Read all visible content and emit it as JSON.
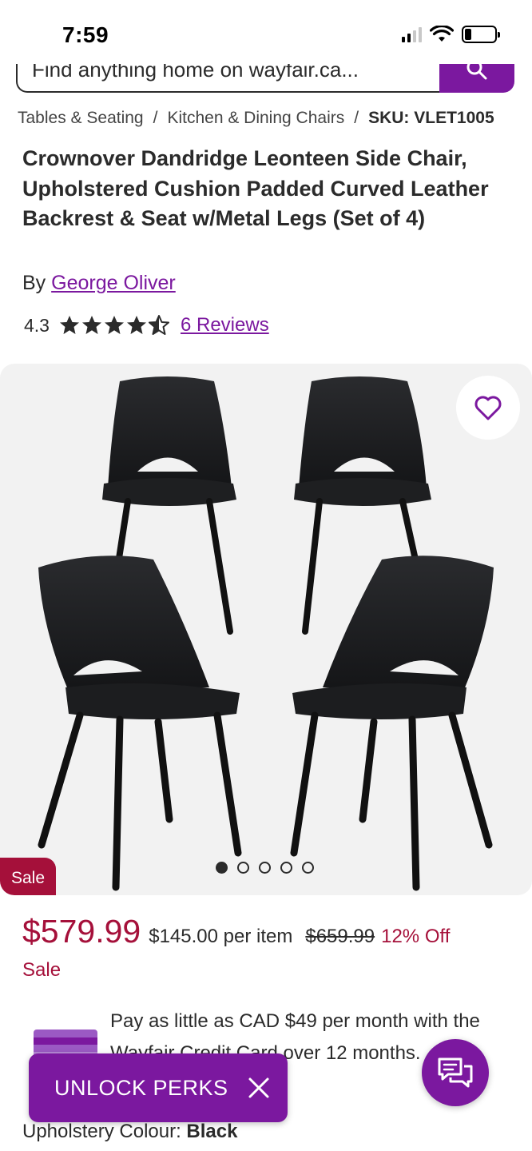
{
  "status_bar": {
    "time": "7:59"
  },
  "search": {
    "placeholder": "Find anything home on wayfair.ca..."
  },
  "breadcrumb": {
    "items": [
      "Tables & Seating",
      "Kitchen & Dining Chairs"
    ],
    "sku": "SKU: VLET1005",
    "separator": "/"
  },
  "product": {
    "title": "Crownover Dandridge Leonteen Side Chair, Upholstered Cushion Padded Curved Leather Backrest & Seat w/Metal Legs (Set of 4)",
    "brand_prefix": "By",
    "brand": "George Oliver",
    "rating": "4.3",
    "rating_value": 4.3,
    "reviews_label": "6 Reviews"
  },
  "gallery": {
    "badge": "Sale",
    "dot_count": 5,
    "active_dot": 0
  },
  "pricing": {
    "sale_price": "$579.99",
    "per_item": "$145.00 per item",
    "original_price": "$659.99",
    "discount": "12% Off",
    "sale_label": "Sale"
  },
  "credit_promo": {
    "text": "Pay as little as CAD $49 per month with the Wayfair Credit Card over 12 months."
  },
  "unlock_perks": {
    "label": "UNLOCK PERKS"
  },
  "options": {
    "label": "Upholstery Colour:",
    "value": "Black"
  },
  "colors": {
    "brand_purple": "#7b189f",
    "sale_red": "#a5103a",
    "text": "#2b2b2b"
  },
  "icons": {
    "search": "search-icon",
    "favorite": "heart-icon",
    "close": "close-icon",
    "chat": "chat-icon",
    "star": "star-icon",
    "card": "credit-card-icon"
  }
}
